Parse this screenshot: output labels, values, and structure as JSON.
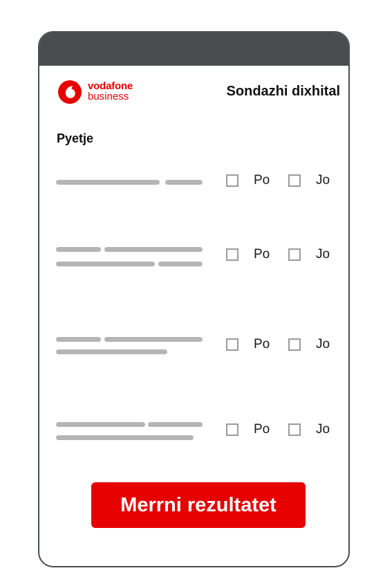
{
  "brand": {
    "line1": "vodafone",
    "line2": "business",
    "color": "#e60000",
    "icon": "vodafone-speechmark-icon"
  },
  "header": {
    "title": "Sondazhi dixhital",
    "bar_color": "#4a4d4e"
  },
  "questions_label": "Pyetje",
  "questions": [
    {
      "yes_label": "Po",
      "no_label": "Jo"
    },
    {
      "yes_label": "Po",
      "no_label": "Jo"
    },
    {
      "yes_label": "Po",
      "no_label": "Jo"
    },
    {
      "yes_label": "Po",
      "no_label": "Jo"
    }
  ],
  "submit": {
    "label": "Merrni rezultatet",
    "color": "#e60000"
  },
  "placeholder_color": "#b5b5b5",
  "checkbox_border_color": "#9b9b9b"
}
